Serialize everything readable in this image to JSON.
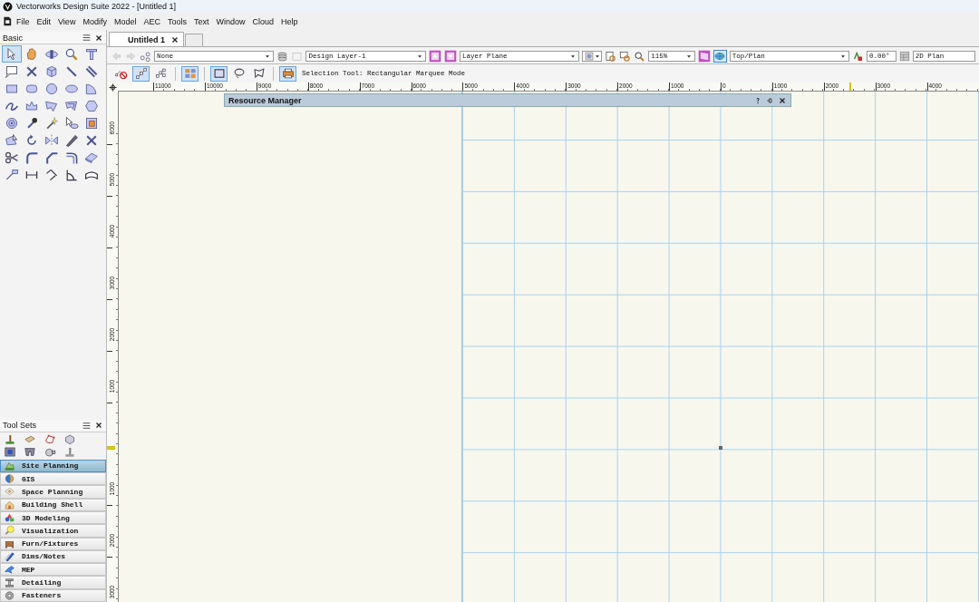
{
  "window": {
    "title": "Vectorworks Design Suite 2022 - [Untitled 1]"
  },
  "menu": [
    "File",
    "Edit",
    "View",
    "Modify",
    "Model",
    "AEC",
    "Tools",
    "Text",
    "Window",
    "Cloud",
    "Help"
  ],
  "basic_palette": {
    "title": "Basic",
    "tools": [
      {
        "selected": true
      },
      {
        "selected": false
      },
      {
        "selected": false
      },
      {
        "selected": false
      },
      {
        "selected": false
      },
      {
        "selected": false
      },
      {
        "selected": false
      },
      {
        "selected": false
      },
      {
        "selected": false
      },
      {
        "selected": false
      },
      {
        "selected": false
      },
      {
        "selected": false
      },
      {
        "selected": false
      },
      {
        "selected": false
      },
      {
        "selected": false
      },
      {
        "selected": false
      },
      {
        "selected": false
      },
      {
        "selected": false
      },
      {
        "selected": false
      },
      {
        "selected": false
      },
      {
        "selected": false
      },
      {
        "selected": false
      },
      {
        "selected": false
      },
      {
        "selected": false
      },
      {
        "selected": false
      },
      {
        "selected": false
      },
      {
        "selected": false
      },
      {
        "selected": false
      },
      {
        "selected": false
      },
      {
        "selected": false
      },
      {
        "selected": false
      },
      {
        "selected": false
      },
      {
        "selected": false
      },
      {
        "selected": false
      },
      {
        "selected": false
      },
      {
        "selected": false
      },
      {
        "selected": false
      },
      {
        "selected": false
      },
      {
        "selected": false
      },
      {
        "selected": false
      }
    ]
  },
  "tool_sets": {
    "title": "Tool Sets",
    "items": [
      {
        "label": "Site Planning",
        "selected": true
      },
      {
        "label": "GIS",
        "selected": false
      },
      {
        "label": "Space Planning",
        "selected": false
      },
      {
        "label": "Building Shell",
        "selected": false
      },
      {
        "label": "3D Modeling",
        "selected": false
      },
      {
        "label": "Visualization",
        "selected": false
      },
      {
        "label": "Furn/Fixtures",
        "selected": false
      },
      {
        "label": "Dims/Notes",
        "selected": false
      },
      {
        "label": "MEP",
        "selected": false
      },
      {
        "label": "Detailing",
        "selected": false
      },
      {
        "label": "Fasteners",
        "selected": false
      }
    ]
  },
  "document_tabs": [
    {
      "label": "Untitled 1",
      "selected": true
    }
  ],
  "view_bar": {
    "class": "None",
    "layer": "Design Layer-1",
    "plane": "Layer Plane",
    "zoom": "115%",
    "view": "Top/Plan",
    "rotation": "0.00°",
    "render": "2D Plan"
  },
  "mode_bar": {
    "modes": [
      {
        "selected": false
      },
      {
        "selected": true
      },
      {
        "selected": false
      },
      {
        "selected": true
      },
      {
        "selected": true
      },
      {
        "selected": false
      },
      {
        "selected": false
      },
      {
        "selected": true
      }
    ],
    "status": "Selection Tool: Rectangular Marquee Mode"
  },
  "rulers": {
    "horizontal": [
      "11000",
      "10000",
      "9000",
      "8000",
      "7000",
      "6000",
      "5000",
      "4000",
      "3000",
      "2000",
      "1000",
      "0",
      "1000",
      "2000",
      "3000",
      "4000"
    ],
    "vertical": [
      "6000",
      "5000",
      "4000",
      "3000",
      "2000",
      "1000",
      "1000",
      "2000",
      "3000"
    ]
  },
  "resource_manager": {
    "title": "Resource Manager"
  }
}
